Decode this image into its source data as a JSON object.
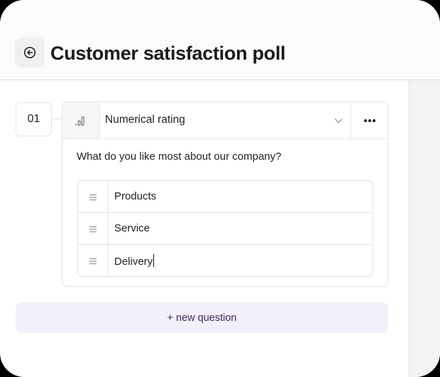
{
  "header": {
    "title": "Customer satisfaction poll",
    "back_icon": "back-arrow-circle-icon"
  },
  "question": {
    "number": "01",
    "type_label": "Numerical rating",
    "type_icon": "bar-rating-icon",
    "dropdown_icon": "chevron-down-icon",
    "more_icon": "more-horizontal-icon",
    "text": "What do you like most about our company?",
    "options": [
      {
        "label": "Products"
      },
      {
        "label": "Service"
      },
      {
        "label": "Delivery"
      }
    ]
  },
  "actions": {
    "new_question_label": "+ new question"
  },
  "colors": {
    "accent_bg": "#f3f0fa",
    "accent_text": "#3a2a55"
  }
}
